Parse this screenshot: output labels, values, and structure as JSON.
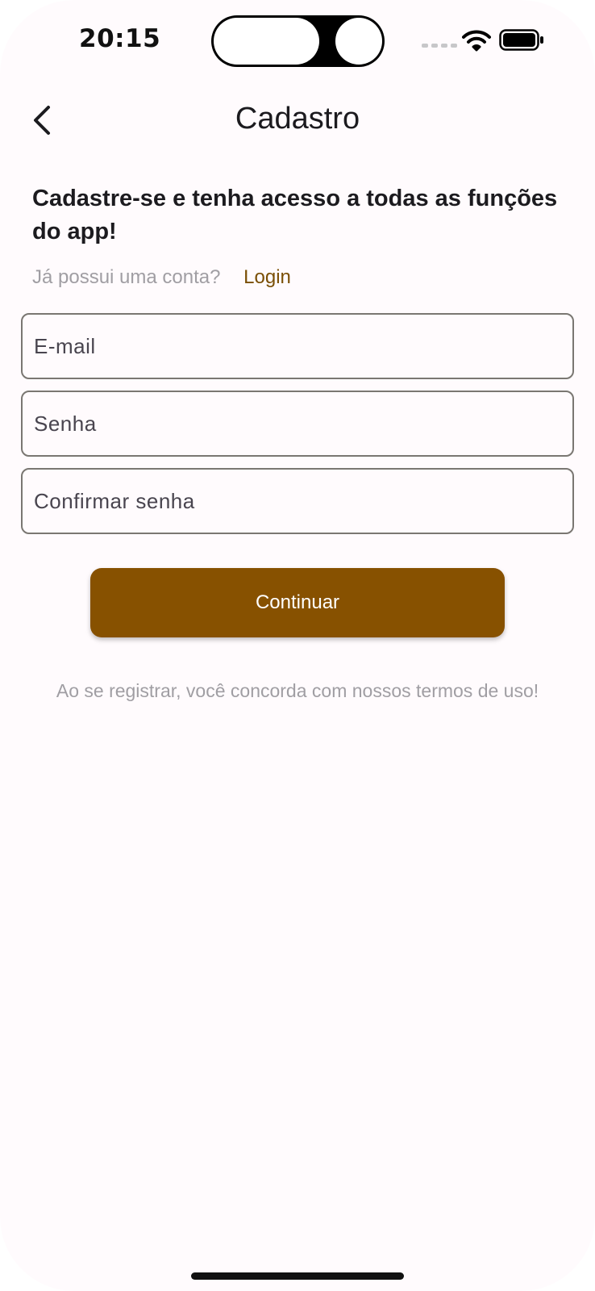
{
  "status_bar": {
    "time": "20:15",
    "icons": [
      "cellular-signal-icon",
      "wifi-icon",
      "battery-icon"
    ]
  },
  "header": {
    "back_icon": "chevron-left-icon",
    "title": "Cadastro"
  },
  "content": {
    "headline": "Cadastre-se e tenha acesso a todas as funções do app!",
    "account_question": "Já possui uma conta?",
    "login_link": "Login"
  },
  "form": {
    "email_placeholder": "E-mail",
    "password_placeholder": "Senha",
    "confirm_password_placeholder": "Confirmar senha",
    "continue_label": "Continuar"
  },
  "footer": {
    "terms_text": "Ao se registrar, você concorda com nossos termos de uso!"
  },
  "colors": {
    "primary": "#875100",
    "link": "#7a4f05",
    "muted_text": "#a09ea3",
    "background": "#fffbfd",
    "field_border": "#7a7772"
  }
}
